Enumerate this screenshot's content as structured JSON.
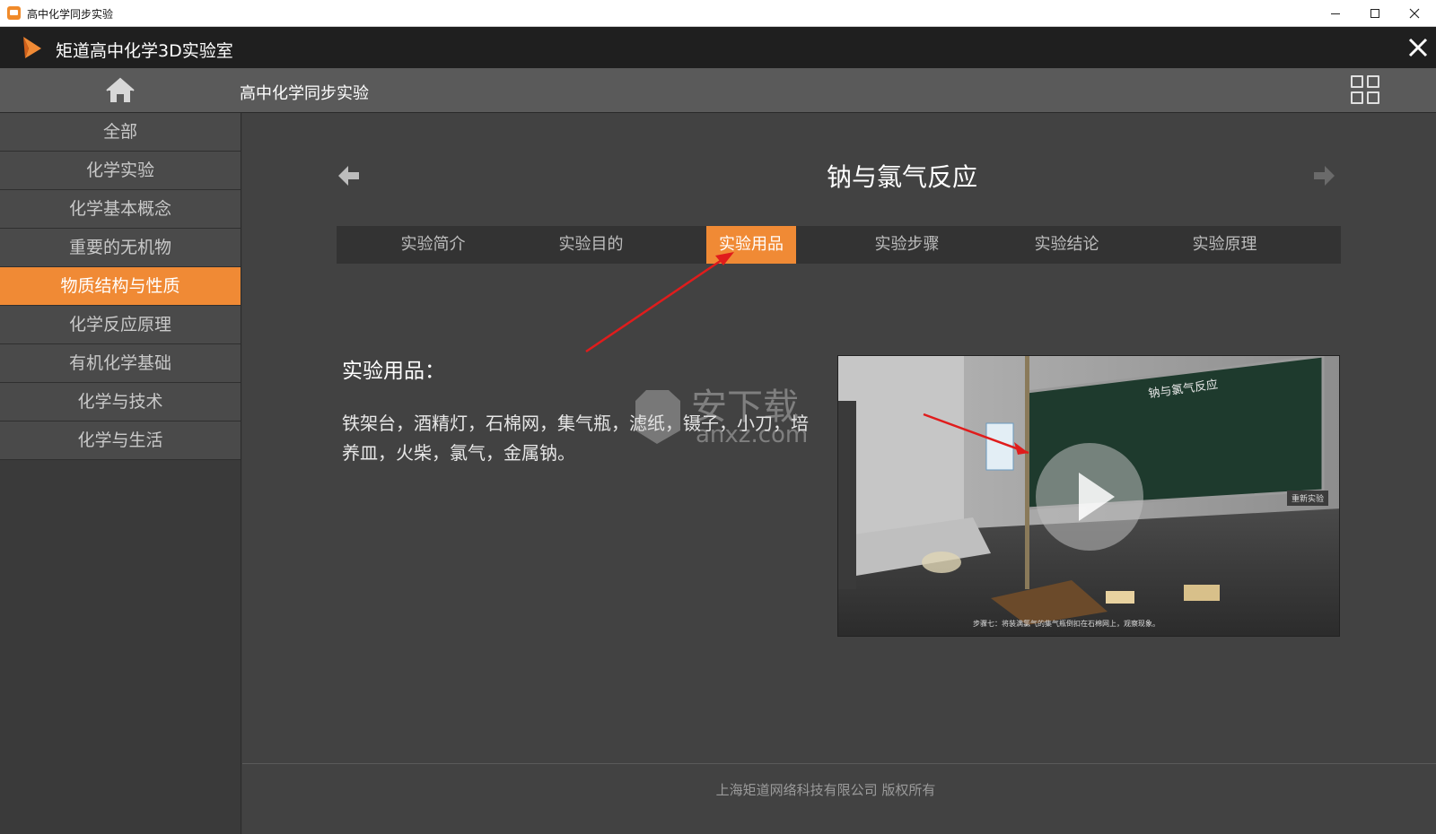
{
  "os": {
    "title": "高中化学同步实验",
    "minimize_icon": "minimize-icon",
    "maximize_icon": "maximize-icon",
    "close_icon": "close-icon"
  },
  "app": {
    "title": "矩道高中化学3D实验室",
    "close_glyph": "✕",
    "brand_color": "#f08a35"
  },
  "toolbar": {
    "breadcrumb": "高中化学同步实验"
  },
  "sidebar": {
    "items": [
      {
        "label": "全部"
      },
      {
        "label": "化学实验"
      },
      {
        "label": "化学基本概念"
      },
      {
        "label": "重要的无机物"
      },
      {
        "label": "物质结构与性质",
        "active": true
      },
      {
        "label": "化学反应原理"
      },
      {
        "label": "有机化学基础"
      },
      {
        "label": "化学与技术"
      },
      {
        "label": "化学与生活"
      }
    ]
  },
  "experiment": {
    "title": "钠与氯气反应",
    "tabs": [
      {
        "label": "实验简介"
      },
      {
        "label": "实验目的"
      },
      {
        "label": "实验用品",
        "active": true
      },
      {
        "label": "实验步骤"
      },
      {
        "label": "实验结论"
      },
      {
        "label": "实验原理"
      }
    ],
    "section_heading": "实验用品：",
    "section_text": "铁架台，酒精灯，石棉网，集气瓶，滤纸，镊子，小刀，培养皿，火柴，氯气，金属钠。"
  },
  "preview": {
    "chalkboard_title": "钠与氯气反应",
    "restart_label": "重新实验",
    "caption": "步骤七：将装满氯气的集气瓶倒扣在石棉网上，观察现象。"
  },
  "footer": {
    "text": "上海矩道网络科技有限公司 版权所有"
  }
}
